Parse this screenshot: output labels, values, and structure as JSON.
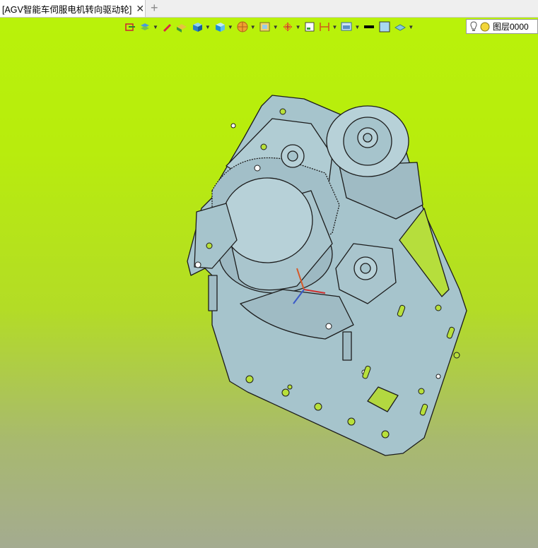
{
  "tab": {
    "title": "[AGV智能车伺服电机转向驱动轮]",
    "close_glyph": "✕",
    "add_glyph": "+"
  },
  "layer": {
    "name": "图层0000"
  },
  "toolbar": {
    "icons": [
      "exit-icon",
      "layers-icon",
      "pen-icon",
      "render-icon",
      "shaded-cube-icon",
      "view-cube-icon",
      "sphere-icon",
      "frame-icon",
      "axes-icon",
      "fit-icon",
      "dimension-icon",
      "display-icon",
      "color-black-icon",
      "fill-color-icon",
      "plane-icon"
    ]
  },
  "colors": {
    "background_top": "#b9f20a",
    "background_bottom": "#a4ab90",
    "model": "#a6c4cc",
    "model_edge": "#1c1c1c"
  }
}
